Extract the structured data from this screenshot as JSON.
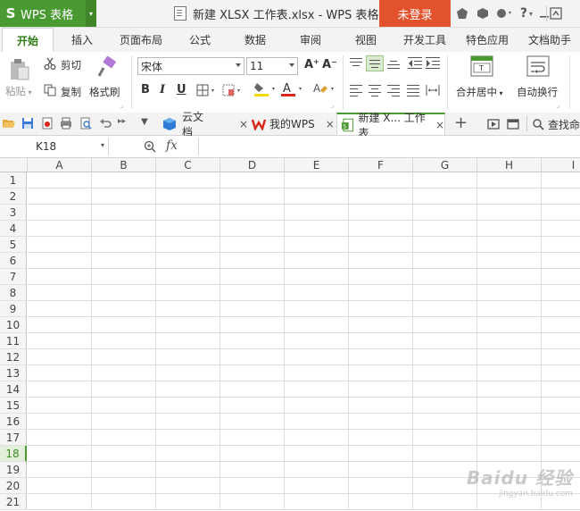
{
  "app": {
    "logo": "S",
    "name": "WPS 表格",
    "menu_arrow": "▾"
  },
  "window_title": "新建 XLSX 工作表.xlsx - WPS 表格",
  "login_label": "未登录",
  "ribbon_tabs": [
    "开始",
    "插入",
    "页面布局",
    "公式",
    "数据",
    "审阅",
    "视图",
    "开发工具",
    "特色应用",
    "文档助手"
  ],
  "active_tab": "开始",
  "clipboard": {
    "paste": "粘贴",
    "cut": "剪切",
    "copy": "复制",
    "format_painter": "格式刷"
  },
  "font": {
    "name": "宋体",
    "size": "11",
    "grow": "A⁺",
    "shrink": "A⁻",
    "bold": "B",
    "italic": "I",
    "underline": "U"
  },
  "colors": {
    "accent": "#4a9a32",
    "login": "#e2522d",
    "fill_color": "#f5d800",
    "font_color": "#d9261c"
  },
  "alignment": {
    "merge_center": "合并居中",
    "wrap_text": "自动换行"
  },
  "doc_tabs": [
    {
      "label": "云文档",
      "icon": "cloud-cube-icon"
    },
    {
      "label": "我的WPS",
      "icon": "wps-logo-icon"
    },
    {
      "label": "新建 X... 工作表",
      "icon": "spreadsheet-icon"
    }
  ],
  "search_label": "查找命",
  "name_box": "K18",
  "fx_label": "fx",
  "formula_value": "",
  "columns": [
    "A",
    "B",
    "C",
    "D",
    "E",
    "F",
    "G",
    "H",
    "I"
  ],
  "rows": [
    "1",
    "2",
    "3",
    "4",
    "5",
    "6",
    "7",
    "8",
    "9",
    "10",
    "11",
    "12",
    "13",
    "14",
    "15",
    "16",
    "17",
    "18",
    "19",
    "20",
    "21"
  ],
  "active_row": "18",
  "watermark": {
    "text": "Baidu 经验",
    "sub": "jingyan.baidu.com"
  }
}
